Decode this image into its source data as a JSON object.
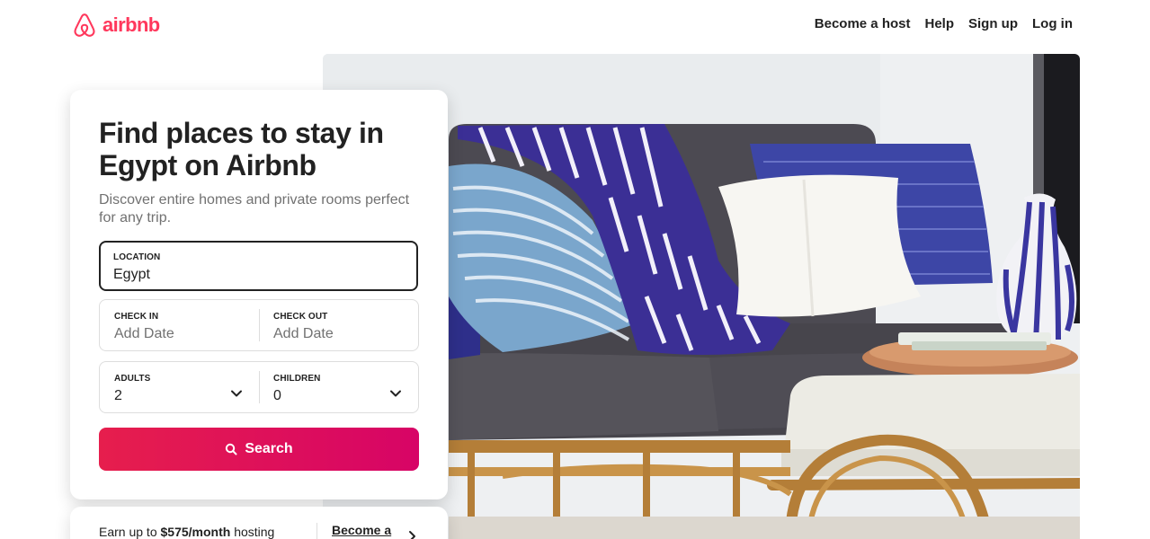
{
  "header": {
    "logo_text": "airbnb",
    "brand_color": "#ff385c",
    "nav": [
      {
        "label": "Become a host"
      },
      {
        "label": "Help"
      },
      {
        "label": "Sign up"
      },
      {
        "label": "Log in"
      }
    ]
  },
  "search_card": {
    "title": "Find places to stay in Egypt on Airbnb",
    "subtitle": "Discover entire homes and private rooms perfect for any trip.",
    "location": {
      "label": "LOCATION",
      "value": "Egypt"
    },
    "check_in": {
      "label": "CHECK IN",
      "placeholder": "Add Date"
    },
    "check_out": {
      "label": "CHECK OUT",
      "placeholder": "Add Date"
    },
    "adults": {
      "label": "ADULTS",
      "value": "2"
    },
    "children": {
      "label": "CHILDREN",
      "value": "0"
    },
    "search_button": {
      "label": "Search",
      "colors": [
        "#e61e4d",
        "#d70466"
      ]
    }
  },
  "host_promo": {
    "text_prefix": "Earn up to ",
    "amount": "$575/month",
    "text_suffix": " hosting",
    "link_label": "Become a"
  },
  "icons": {
    "logo": "airbnb-belo-icon",
    "search": "search-icon",
    "dropdown": "chevron-down-icon",
    "arrow": "chevron-right-icon"
  }
}
